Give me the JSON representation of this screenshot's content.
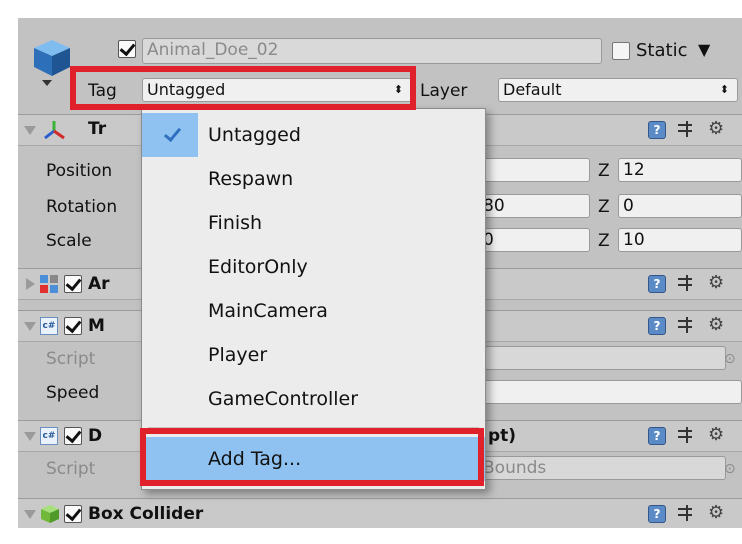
{
  "object": {
    "name": "Animal_Doe_02",
    "static_label": "Static",
    "tag_label": "Tag",
    "tag_value": "Untagged",
    "layer_label": "Layer",
    "layer_value": "Default"
  },
  "transform": {
    "title": "Tr",
    "rows": [
      {
        "label": "Position",
        "x": "",
        "y": "",
        "z": "12"
      },
      {
        "label": "Rotation",
        "x": "",
        "y": "80",
        "z": "0"
      },
      {
        "label": "Scale",
        "x": "",
        "y": "0",
        "z": "10"
      }
    ],
    "z_axis": "Z"
  },
  "components": [
    {
      "title": "Ar"
    },
    {
      "title": "M",
      "script_label": "Script",
      "speed_label": "Speed"
    },
    {
      "title": "D",
      "title_tail": "pt)",
      "script_label": "Script",
      "script_value": "Bounds"
    },
    {
      "title": "Box Collider"
    }
  ],
  "dropdown": {
    "items": [
      "Untagged",
      "Respawn",
      "Finish",
      "EditorOnly",
      "MainCamera",
      "Player",
      "GameController"
    ],
    "selected": "Untagged",
    "add_tag": "Add Tag..."
  },
  "icons": {
    "help": "?",
    "gear": "⚙",
    "object_select": "⊙",
    "dropdown_arrow": "▼",
    "select_arrows": "⬍"
  },
  "colors": {
    "highlight": "#e0202a",
    "menu_hover": "#8fc2f0",
    "panel": "#c2c2c2"
  }
}
